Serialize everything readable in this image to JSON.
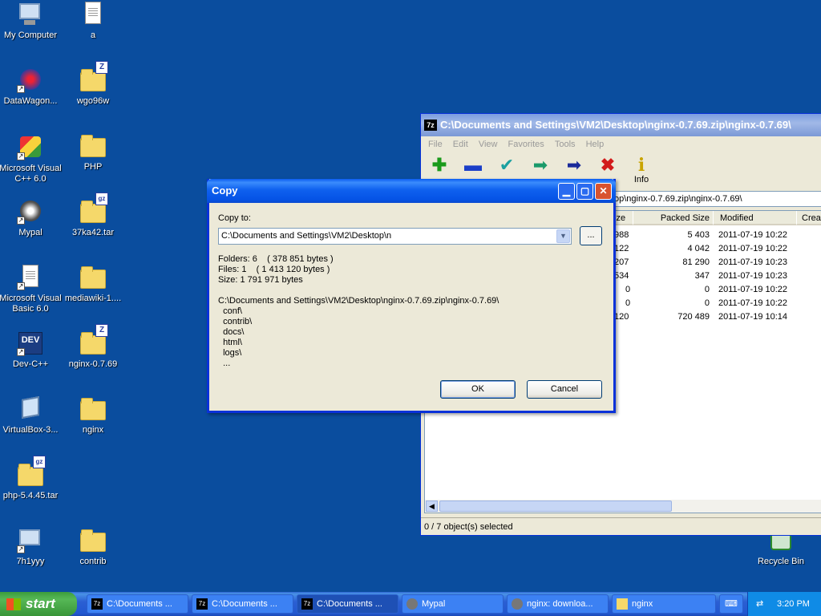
{
  "desktop": {
    "icons": [
      {
        "label": "My Computer"
      },
      {
        "label": "a"
      },
      {
        "label": "DataWagon..."
      },
      {
        "label": "wgo96w"
      },
      {
        "label": "Microsoft Visual C++ 6.0"
      },
      {
        "label": "PHP"
      },
      {
        "label": "Mypal"
      },
      {
        "label": "37ka42.tar"
      },
      {
        "label": "Microsoft Visual Basic 6.0"
      },
      {
        "label": "mediawiki-1...."
      },
      {
        "label": "Dev-C++"
      },
      {
        "label": "nginx-0.7.69"
      },
      {
        "label": "VirtualBox-3..."
      },
      {
        "label": "nginx"
      },
      {
        "label": "php-5.4.45.tar"
      },
      {
        "label": "7h1yyy"
      },
      {
        "label": "contrib"
      },
      {
        "label": "Recycle Bin"
      }
    ],
    "badges": {
      "zip": "Z",
      "gz": "gz",
      "dev": "DEV",
      "sevenzip": "7z"
    }
  },
  "zip_window": {
    "title": "C:\\Documents and Settings\\VM2\\Desktop\\nginx-0.7.69.zip\\nginx-0.7.69\\",
    "menu": [
      "File",
      "Edit",
      "View",
      "Favorites",
      "Tools",
      "Help"
    ],
    "toolbar": [
      "",
      "",
      "",
      "",
      "",
      "",
      "Info"
    ],
    "address": "op\\nginx-0.7.69.zip\\nginx-0.7.69\\",
    "columns": [
      "ize",
      "Packed Size",
      "Modified",
      "Creat"
    ],
    "rows": [
      {
        "size": "988",
        "packed": "5 403",
        "modified": "2011-07-19 10:22"
      },
      {
        "size": "122",
        "packed": "4 042",
        "modified": "2011-07-19 10:22"
      },
      {
        "size": "207",
        "packed": "81 290",
        "modified": "2011-07-19 10:23"
      },
      {
        "size": "534",
        "packed": "347",
        "modified": "2011-07-19 10:23"
      },
      {
        "size": "0",
        "packed": "0",
        "modified": "2011-07-19 10:22"
      },
      {
        "size": "0",
        "packed": "0",
        "modified": "2011-07-19 10:22"
      },
      {
        "size": "120",
        "packed": "720 489",
        "modified": "2011-07-19 10:14"
      }
    ],
    "status": "0 / 7 object(s) selected"
  },
  "copy_dialog": {
    "title": "Copy",
    "copy_to_label": "Copy to:",
    "destination": "C:\\Documents and Settings\\VM2\\Desktop\\n",
    "browse": "...",
    "info": "Folders: 6    ( 378 851 bytes )\nFiles: 1    ( 1 413 120 bytes )\nSize: 1 791 971 bytes",
    "paths": "C:\\Documents and Settings\\VM2\\Desktop\\nginx-0.7.69.zip\\nginx-0.7.69\\\n  conf\\\n  contrib\\\n  docs\\\n  html\\\n  logs\\\n  ...",
    "ok": "OK",
    "cancel": "Cancel"
  },
  "taskbar": {
    "start": "start",
    "tasks": [
      {
        "label": "C:\\Documents ..."
      },
      {
        "label": "C:\\Documents ..."
      },
      {
        "label": "C:\\Documents ..."
      },
      {
        "label": "Mypal"
      },
      {
        "label": "nginx: downloa..."
      },
      {
        "label": "nginx"
      }
    ],
    "clock": "3:20 PM"
  }
}
